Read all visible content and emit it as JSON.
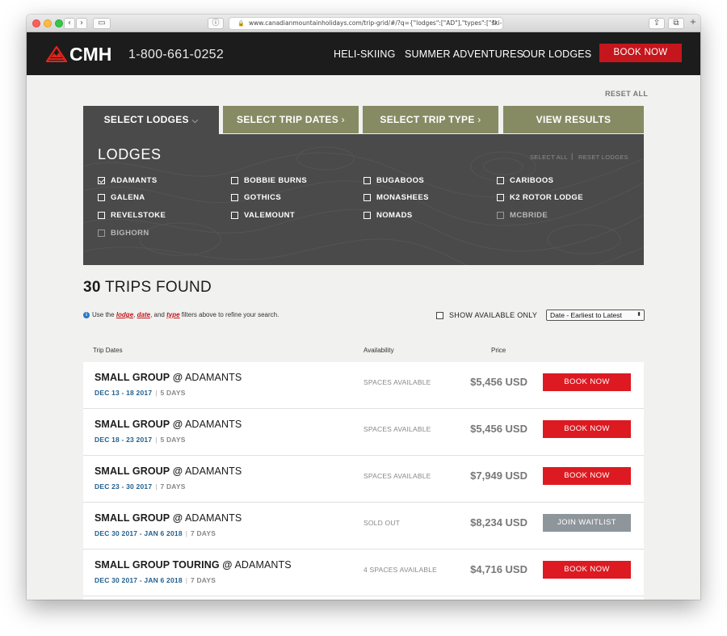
{
  "browser": {
    "url": "www.canadianmountainholidays.com/trip-grid/#/?q={\"lodges\":[\"AD\"],\"types\":[\"ski-MAX\"|"
  },
  "header": {
    "logo": "CMH",
    "phone": "1-800-661-0252",
    "nav": [
      "HELI-SKIING",
      "SUMMER ADVENTURES",
      "OUR LODGES"
    ],
    "book_now": "BOOK NOW"
  },
  "filters": {
    "reset_all": "RESET ALL",
    "tabs": [
      "SELECT LODGES",
      "SELECT TRIP DATES",
      "SELECT TRIP TYPE",
      "VIEW RESULTS"
    ],
    "lodges_title": "LODGES",
    "select_all": "SELECT ALL",
    "separator": "|",
    "reset_lodges": "RESET LODGES",
    "lodges": [
      {
        "name": "ADAMANTS",
        "checked": true,
        "enabled": true
      },
      {
        "name": "BOBBIE BURNS",
        "checked": false,
        "enabled": true
      },
      {
        "name": "BUGABOOS",
        "checked": false,
        "enabled": true
      },
      {
        "name": "CARIBOOS",
        "checked": false,
        "enabled": true
      },
      {
        "name": "GALENA",
        "checked": false,
        "enabled": true
      },
      {
        "name": "GOTHICS",
        "checked": false,
        "enabled": true
      },
      {
        "name": "MONASHEES",
        "checked": false,
        "enabled": true
      },
      {
        "name": "K2 ROTOR LODGE",
        "checked": false,
        "enabled": true
      },
      {
        "name": "REVELSTOKE",
        "checked": false,
        "enabled": true
      },
      {
        "name": "VALEMOUNT",
        "checked": false,
        "enabled": true
      },
      {
        "name": "NOMADS",
        "checked": false,
        "enabled": true
      },
      {
        "name": "MCBRIDE",
        "checked": false,
        "enabled": false
      },
      {
        "name": "BIGHORN",
        "checked": false,
        "enabled": false
      }
    ]
  },
  "results": {
    "count": "30",
    "count_label": "TRIPS FOUND",
    "hint_pre": "Use the",
    "hint_lodge": "lodge",
    "hint_comma": ",",
    "hint_date": "date",
    "hint_and": ", and",
    "hint_type": "type",
    "hint_post": "filters above to refine your search.",
    "show_available": "SHOW AVAILABLE ONLY",
    "sort": "Date - Earliest to Latest",
    "col_dates": "Trip Dates",
    "col_availability": "Availability",
    "col_price": "Price",
    "trips": [
      {
        "group": "SMALL GROUP",
        "at": "@",
        "lodge": "ADAMANTS",
        "dates": "DEC 13 - 18 2017",
        "days": "5 DAYS",
        "availability": "SPACES AVAILABLE",
        "price": "$5,456 USD",
        "action": "BOOK NOW"
      },
      {
        "group": "SMALL GROUP",
        "at": "@",
        "lodge": "ADAMANTS",
        "dates": "DEC 18 - 23 2017",
        "days": "5 DAYS",
        "availability": "SPACES AVAILABLE",
        "price": "$5,456 USD",
        "action": "BOOK NOW"
      },
      {
        "group": "SMALL GROUP",
        "at": "@",
        "lodge": "ADAMANTS",
        "dates": "DEC 23 - 30 2017",
        "days": "7 DAYS",
        "availability": "SPACES AVAILABLE",
        "price": "$7,949 USD",
        "action": "BOOK NOW"
      },
      {
        "group": "SMALL GROUP",
        "at": "@",
        "lodge": "ADAMANTS",
        "dates": "DEC 30 2017 - JAN 6 2018",
        "days": "7 DAYS",
        "availability": "SOLD OUT",
        "price": "$8,234 USD",
        "action": "JOIN WAITLIST"
      },
      {
        "group": "SMALL GROUP TOURING",
        "at": "@",
        "lodge": "ADAMANTS",
        "dates": "DEC 30 2017 - JAN 6 2018",
        "days": "7 DAYS",
        "availability": "4 SPACES AVAILABLE",
        "price": "$4,716 USD",
        "action": "BOOK NOW"
      }
    ]
  },
  "colors": {
    "accent_red": "#dd1a21",
    "olive_tab": "#878b64",
    "panel_gray": "#4a4a4a",
    "date_blue": "#1f5f8f"
  }
}
